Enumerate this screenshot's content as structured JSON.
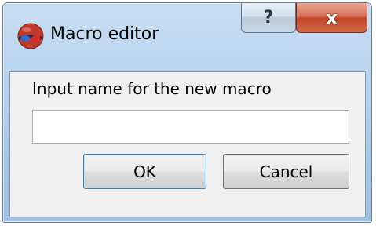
{
  "window": {
    "title": "Macro editor",
    "help_label": "?",
    "close_label": "x"
  },
  "dialog": {
    "prompt": "Input name for the new macro",
    "input_value": "",
    "input_placeholder": "",
    "ok_label": "OK",
    "cancel_label": "Cancel"
  },
  "icons": {
    "app": "3d-glasses-icon",
    "help": "help-icon",
    "close": "close-icon"
  },
  "colors": {
    "title_bar": "#b8d3ee",
    "close_button": "#c24528",
    "default_button_border": "#3c7fb1"
  }
}
